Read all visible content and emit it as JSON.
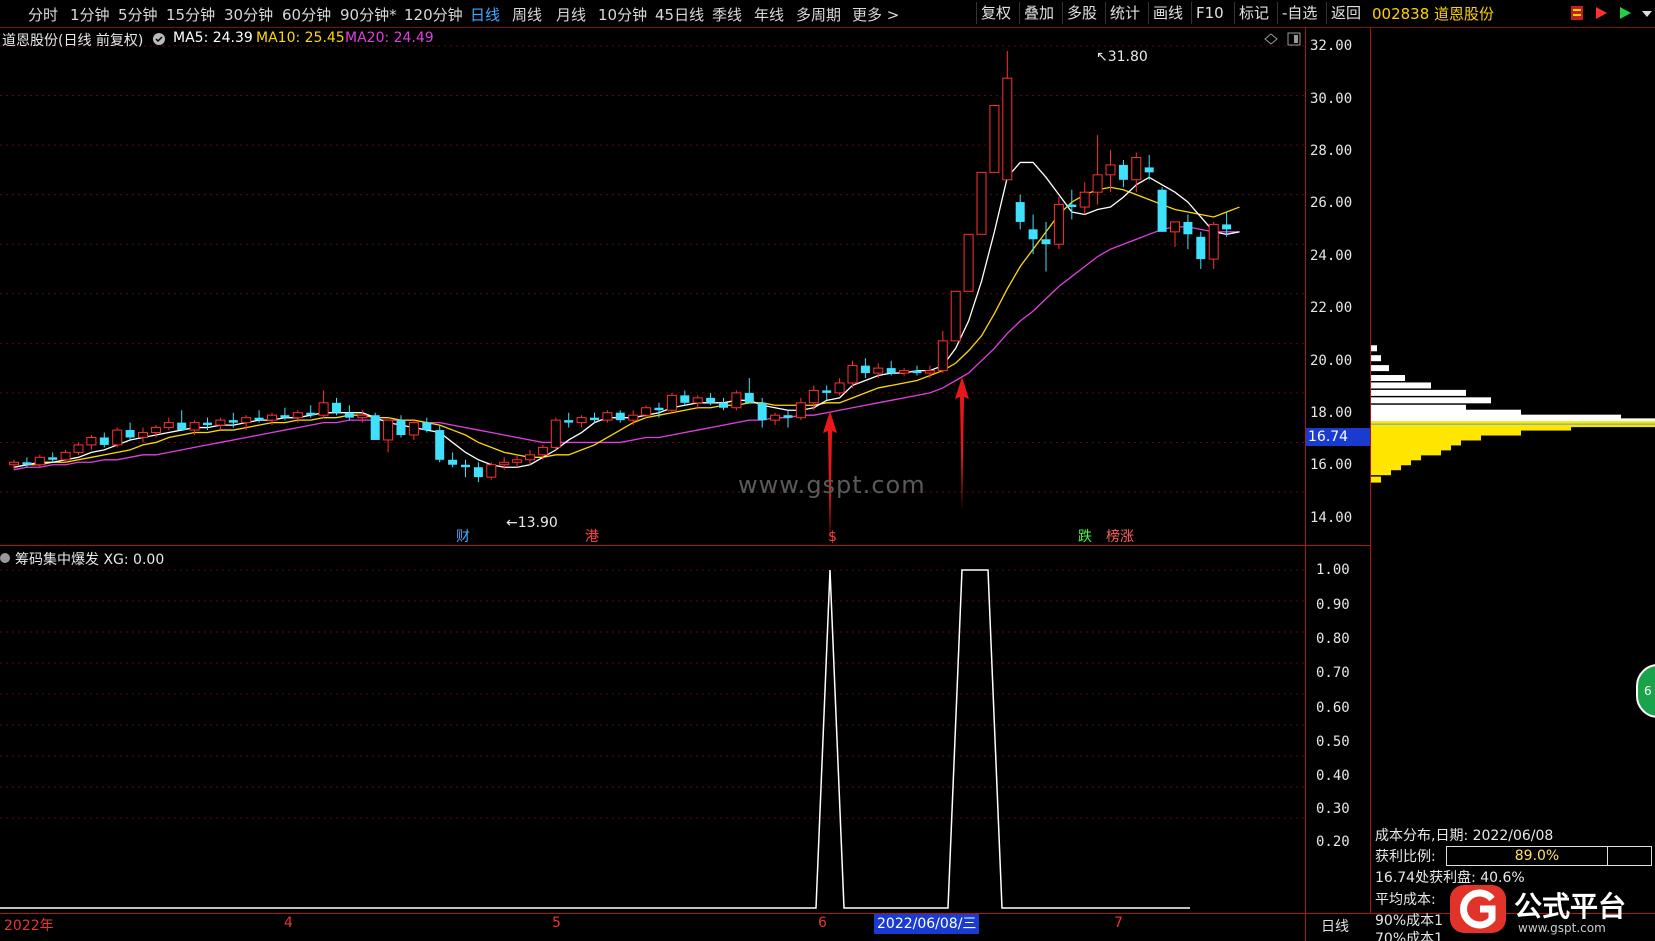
{
  "toolbar": {
    "periods": [
      "分时",
      "1分钟",
      "5分钟",
      "15分钟",
      "30分钟",
      "60分钟",
      "90分钟*",
      "120分钟",
      "日线",
      "周线",
      "月线",
      "10分钟",
      "45日线",
      "季线",
      "年线",
      "多周期",
      "更多 >"
    ],
    "active_period": "日线",
    "buttons": [
      "复权",
      "叠加",
      "多股",
      "统计",
      "画线",
      "F10",
      "标记",
      "-自选",
      "返回"
    ],
    "stock_code_name": "002838 道恩股份"
  },
  "price_legend": {
    "title": "道恩股份(日线 前复权)",
    "ma5": "MA5: 24.39",
    "ma10": "MA10: 25.45",
    "ma20": "MA20: 24.49",
    "colors": {
      "ma5": "#ffffff",
      "ma10": "#ffd800",
      "ma20": "#e040e0"
    }
  },
  "price_axis": {
    "labels": [
      "32.00",
      "30.00",
      "28.00",
      "26.00",
      "24.00",
      "22.00",
      "20.00",
      "18.00",
      "16.00",
      "14.00"
    ],
    "current_price": "16.74"
  },
  "price_annotations": {
    "high": "31.80",
    "low": "13.90"
  },
  "event_tags": [
    {
      "text": "财",
      "color": "#4da6ff"
    },
    {
      "text": "港",
      "color": "#ff4040"
    },
    {
      "text": "$",
      "color": "#ff4040"
    },
    {
      "text": "跌",
      "color": "#40ff40"
    },
    {
      "text": "榜涨",
      "color": "#ff6060"
    }
  ],
  "watermark": "www.gspt.com",
  "indicator": {
    "legend": "筹码集中爆发  XG: 0.00",
    "axis_labels": [
      "1.00",
      "0.90",
      "0.80",
      "0.70",
      "0.60",
      "0.50",
      "0.40",
      "0.30",
      "0.20"
    ]
  },
  "timeline": {
    "labels": [
      "2022年",
      "4",
      "5",
      "6",
      "7"
    ],
    "cursor_date": "2022/06/08/三",
    "period": "日线"
  },
  "cost_panel": {
    "title": "成本分布,日期:  2022/06/08",
    "profit_label": "获利比例:",
    "profit_value": "89.0%",
    "profit_ratio": 0.89,
    "line3": "16.74处获利盘: 40.6%",
    "line4": "平均成本:",
    "line5": "90%成本1",
    "line6": "70%成本1"
  },
  "brand": {
    "name": "公式平台",
    "url": "www.gspt.com"
  },
  "side_badge": "6",
  "chart_data": {
    "type": "candlestick",
    "y_range": [
      13.4,
      32.6
    ],
    "candles": [
      [
        15.1,
        15.3,
        14.9,
        15.2
      ],
      [
        15.2,
        15.4,
        15.0,
        15.1
      ],
      [
        15.1,
        15.5,
        15.0,
        15.4
      ],
      [
        15.4,
        15.6,
        15.2,
        15.3
      ],
      [
        15.3,
        15.7,
        15.2,
        15.6
      ],
      [
        15.6,
        16.0,
        15.5,
        15.9
      ],
      [
        15.9,
        16.3,
        15.7,
        16.2
      ],
      [
        16.2,
        16.4,
        15.8,
        15.9
      ],
      [
        15.9,
        16.6,
        15.8,
        16.5
      ],
      [
        16.5,
        16.8,
        16.1,
        16.2
      ],
      [
        16.2,
        16.6,
        16.0,
        16.4
      ],
      [
        16.4,
        16.7,
        16.2,
        16.6
      ],
      [
        16.6,
        17.0,
        16.5,
        16.8
      ],
      [
        16.8,
        17.3,
        16.6,
        16.5
      ],
      [
        16.5,
        16.9,
        16.3,
        16.8
      ],
      [
        16.8,
        17.0,
        16.5,
        16.7
      ],
      [
        16.7,
        17.0,
        16.5,
        16.9
      ],
      [
        16.9,
        17.2,
        16.6,
        16.8
      ],
      [
        16.8,
        17.1,
        16.5,
        17.0
      ],
      [
        17.0,
        17.3,
        16.8,
        16.9
      ],
      [
        16.9,
        17.2,
        16.7,
        17.1
      ],
      [
        17.1,
        17.4,
        16.9,
        17.0
      ],
      [
        17.0,
        17.3,
        16.8,
        17.2
      ],
      [
        17.2,
        17.5,
        17.0,
        17.1
      ],
      [
        17.1,
        18.1,
        17.0,
        17.6
      ],
      [
        17.6,
        17.8,
        17.1,
        17.2
      ],
      [
        17.2,
        17.5,
        16.9,
        17.0
      ],
      [
        17.0,
        17.3,
        16.8,
        17.1
      ],
      [
        17.1,
        17.2,
        16.2,
        16.1
      ],
      [
        16.1,
        16.9,
        15.6,
        16.9
      ],
      [
        16.9,
        17.1,
        16.2,
        16.3
      ],
      [
        16.3,
        16.9,
        16.1,
        16.8
      ],
      [
        16.8,
        17.0,
        16.4,
        16.5
      ],
      [
        16.5,
        16.7,
        15.2,
        15.3
      ],
      [
        15.3,
        15.6,
        15.0,
        15.1
      ],
      [
        15.1,
        15.3,
        14.6,
        15.0
      ],
      [
        15.0,
        15.2,
        14.4,
        14.6
      ],
      [
        14.6,
        15.2,
        14.5,
        15.1
      ],
      [
        15.1,
        15.4,
        14.9,
        15.2
      ],
      [
        15.2,
        15.5,
        15.0,
        15.3
      ],
      [
        15.3,
        15.7,
        15.1,
        15.5
      ],
      [
        15.5,
        15.9,
        15.3,
        15.8
      ],
      [
        15.8,
        17.0,
        15.7,
        16.9
      ],
      [
        16.9,
        17.2,
        16.6,
        16.8
      ],
      [
        16.8,
        17.1,
        16.6,
        17.0
      ],
      [
        17.0,
        17.2,
        16.8,
        16.9
      ],
      [
        16.9,
        17.3,
        16.8,
        17.2
      ],
      [
        17.2,
        17.3,
        16.8,
        16.9
      ],
      [
        16.9,
        17.3,
        16.7,
        17.1
      ],
      [
        17.1,
        17.5,
        17.0,
        17.4
      ],
      [
        17.4,
        17.6,
        17.0,
        17.3
      ],
      [
        17.3,
        18.0,
        17.2,
        17.9
      ],
      [
        17.9,
        18.1,
        17.5,
        17.6
      ],
      [
        17.6,
        17.9,
        17.4,
        17.8
      ],
      [
        17.8,
        18.0,
        17.5,
        17.6
      ],
      [
        17.6,
        17.8,
        17.3,
        17.4
      ],
      [
        17.4,
        18.1,
        17.3,
        18.0
      ],
      [
        18.0,
        18.6,
        17.7,
        17.6
      ],
      [
        17.6,
        17.8,
        16.6,
        16.9
      ],
      [
        16.9,
        17.2,
        16.7,
        17.1
      ],
      [
        17.1,
        17.3,
        16.6,
        17.0
      ],
      [
        17.0,
        17.8,
        16.9,
        17.6
      ],
      [
        17.6,
        18.3,
        17.3,
        18.1
      ],
      [
        18.1,
        18.3,
        17.7,
        18.0
      ],
      [
        18.0,
        18.6,
        17.9,
        18.4
      ],
      [
        18.4,
        19.3,
        18.2,
        19.1
      ],
      [
        19.1,
        19.4,
        18.6,
        18.8
      ],
      [
        18.8,
        19.2,
        18.6,
        19.0
      ],
      [
        19.0,
        19.3,
        18.7,
        18.8
      ],
      [
        18.8,
        19.0,
        18.7,
        18.9
      ],
      [
        18.9,
        19.1,
        18.7,
        18.8
      ],
      [
        18.8,
        19.1,
        18.6,
        18.9
      ],
      [
        18.9,
        20.5,
        18.8,
        20.1
      ],
      [
        20.1,
        22.1,
        20.1,
        22.1
      ],
      [
        22.1,
        24.4,
        22.1,
        24.4
      ],
      [
        24.4,
        26.9,
        24.4,
        26.9
      ],
      [
        26.9,
        29.6,
        26.9,
        29.6
      ],
      [
        26.6,
        31.8,
        26.6,
        30.7
      ],
      [
        25.7,
        26.0,
        24.6,
        24.9
      ],
      [
        24.6,
        25.2,
        23.6,
        24.2
      ],
      [
        24.2,
        24.9,
        22.9,
        24.0
      ],
      [
        24.0,
        25.9,
        23.8,
        25.6
      ],
      [
        25.6,
        26.2,
        25.0,
        25.5
      ],
      [
        25.5,
        26.5,
        25.2,
        26.1
      ],
      [
        26.1,
        28.4,
        25.6,
        26.8
      ],
      [
        26.8,
        27.8,
        26.1,
        27.2
      ],
      [
        27.2,
        27.4,
        26.3,
        26.6
      ],
      [
        26.6,
        27.7,
        26.1,
        27.5
      ],
      [
        27.1,
        27.6,
        26.6,
        26.9
      ],
      [
        26.2,
        26.3,
        24.5,
        24.5
      ],
      [
        24.5,
        24.9,
        23.9,
        24.9
      ],
      [
        24.9,
        25.2,
        23.8,
        24.4
      ],
      [
        24.3,
        24.5,
        23.0,
        23.4
      ],
      [
        23.4,
        24.9,
        23.0,
        24.8
      ],
      [
        24.8,
        25.3,
        24.3,
        24.6
      ]
    ],
    "ma5": [
      15.0,
      15.1,
      15.2,
      15.2,
      15.3,
      15.4,
      15.6,
      15.7,
      15.9,
      16.1,
      16.2,
      16.3,
      16.4,
      16.5,
      16.6,
      16.6,
      16.7,
      16.7,
      16.8,
      16.9,
      16.9,
      17.0,
      17.0,
      17.1,
      17.2,
      17.2,
      17.2,
      17.2,
      17.0,
      16.8,
      16.7,
      16.6,
      16.5,
      16.4,
      16.0,
      15.6,
      15.3,
      15.1,
      15.0,
      15.0,
      15.1,
      15.4,
      15.7,
      16.1,
      16.4,
      16.8,
      17.0,
      17.0,
      17.0,
      17.1,
      17.2,
      17.4,
      17.5,
      17.6,
      17.6,
      17.6,
      17.7,
      17.7,
      17.5,
      17.4,
      17.3,
      17.3,
      17.4,
      17.7,
      17.8,
      18.3,
      18.5,
      18.7,
      18.8,
      18.8,
      18.9,
      18.9,
      19.1,
      19.8,
      20.9,
      22.5,
      24.5,
      26.7,
      27.3,
      27.3,
      26.7,
      26.0,
      25.3,
      25.2,
      25.4,
      25.5,
      25.9,
      26.4,
      26.7,
      26.4,
      26.1,
      25.7,
      25.1,
      24.5,
      24.4,
      24.5
    ],
    "ma10": [
      15.0,
      15.1,
      15.1,
      15.2,
      15.2,
      15.3,
      15.4,
      15.5,
      15.6,
      15.7,
      15.9,
      16.0,
      16.2,
      16.3,
      16.4,
      16.4,
      16.5,
      16.5,
      16.6,
      16.7,
      16.8,
      16.8,
      16.9,
      16.9,
      17.0,
      17.0,
      17.1,
      17.1,
      17.0,
      17.0,
      16.9,
      16.9,
      16.8,
      16.7,
      16.5,
      16.3,
      16.0,
      15.8,
      15.6,
      15.5,
      15.4,
      15.4,
      15.5,
      15.5,
      15.7,
      15.9,
      16.2,
      16.5,
      16.8,
      17.0,
      17.1,
      17.2,
      17.3,
      17.4,
      17.4,
      17.5,
      17.5,
      17.6,
      17.6,
      17.5,
      17.5,
      17.5,
      17.5,
      17.6,
      17.6,
      17.8,
      18.0,
      18.2,
      18.3,
      18.4,
      18.5,
      18.7,
      18.9,
      19.2,
      19.7,
      20.3,
      21.2,
      22.2,
      23.1,
      23.8,
      24.5,
      25.2,
      25.7,
      26.0,
      26.2,
      26.3,
      26.2,
      26.0,
      25.8,
      25.6,
      25.4,
      25.3,
      25.2,
      25.1,
      25.3,
      25.5
    ],
    "ma20": [
      14.9,
      15.0,
      15.0,
      15.1,
      15.1,
      15.2,
      15.2,
      15.3,
      15.3,
      15.4,
      15.5,
      15.5,
      15.6,
      15.7,
      15.8,
      15.9,
      16.0,
      16.1,
      16.2,
      16.3,
      16.4,
      16.5,
      16.6,
      16.7,
      16.8,
      16.8,
      16.9,
      16.9,
      16.9,
      16.9,
      16.9,
      16.9,
      16.8,
      16.8,
      16.7,
      16.6,
      16.5,
      16.4,
      16.3,
      16.2,
      16.1,
      16.0,
      16.0,
      16.0,
      16.0,
      16.0,
      16.0,
      16.0,
      16.1,
      16.2,
      16.2,
      16.3,
      16.4,
      16.5,
      16.6,
      16.7,
      16.8,
      16.9,
      16.9,
      17.0,
      17.0,
      17.1,
      17.1,
      17.2,
      17.3,
      17.4,
      17.5,
      17.6,
      17.7,
      17.8,
      17.9,
      18.0,
      18.2,
      18.5,
      18.8,
      19.3,
      19.8,
      20.4,
      20.9,
      21.3,
      21.8,
      22.3,
      22.7,
      23.1,
      23.5,
      23.8,
      24.0,
      24.2,
      24.4,
      24.6,
      24.7,
      24.7,
      24.6,
      24.5,
      24.5,
      24.5
    ],
    "xg_signal": [
      [
        830,
        1
      ],
      [
        962,
        1
      ],
      [
        988,
        1
      ]
    ],
    "indicator_y_range": [
      0,
      1.0
    ]
  }
}
